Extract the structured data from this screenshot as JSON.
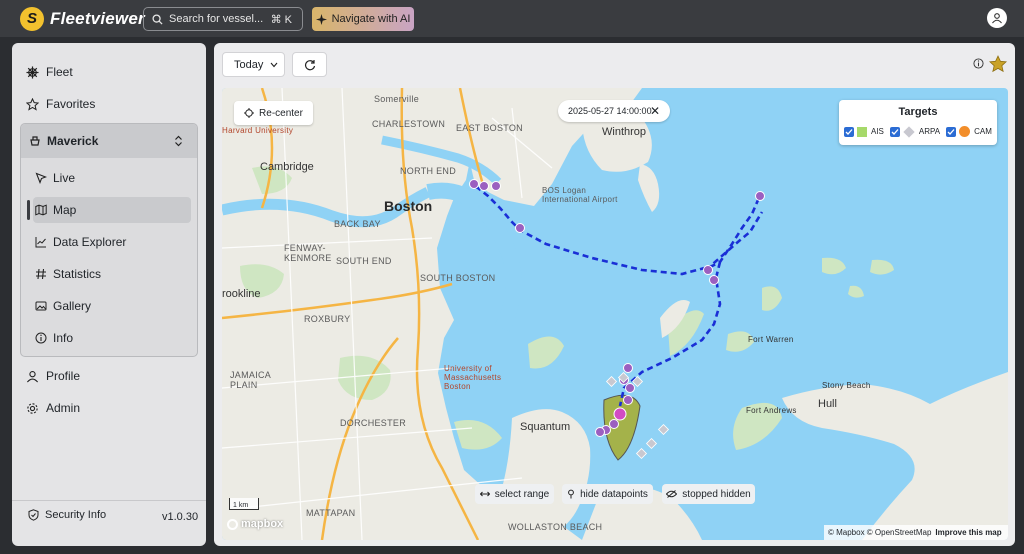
{
  "app": {
    "name": "Fleetviewer"
  },
  "header": {
    "search_placeholder": "Search for vessel...",
    "search_shortcut": "⌘ K",
    "ai_button": "Navigate with AI"
  },
  "sidebar": {
    "fleet": "Fleet",
    "favorites": "Favorites",
    "vessel": "Maverick",
    "vessel_items": [
      "Live",
      "Map",
      "Data Explorer",
      "Statistics",
      "Gallery",
      "Info"
    ],
    "active_item": "Map",
    "profile": "Profile",
    "admin": "Admin",
    "security_info": "Security Info",
    "version": "v1.0.30"
  },
  "toolbar": {
    "range": "Today"
  },
  "map": {
    "recenter": "Re-center",
    "timestamp": "2025-05-27 14:00:00",
    "targets": {
      "title": "Targets",
      "items": [
        {
          "label": "AIS",
          "color": "#a6d96a",
          "checked": true
        },
        {
          "label": "ARPA",
          "color": "#c8c8d0",
          "checked": true
        },
        {
          "label": "CAM",
          "color": "#f28e2b",
          "checked": true
        }
      ]
    },
    "labels": {
      "boston": "Boston",
      "cambridge": "Cambridge",
      "charlestown": "CHARLESTOWN",
      "north_end": "NORTH END",
      "east_boston": "EAST BOSTON",
      "back_bay": "BACK BAY",
      "fenway": "FENWAY-",
      "kenmore": "KENMORE",
      "south_end": "SOUTH END",
      "south_boston": "SOUTH BOSTON",
      "roxbury": "ROXBURY",
      "brookline": "rookline",
      "jamaica_plain": "JAMAICA PLAIN",
      "dorchester": "DORCHESTER",
      "mattapan": "MATTAPAN",
      "wollaston": "WOLLASTON BEACH",
      "squantum": "Squantum",
      "winthrop": "Winthrop",
      "fort_warren": "Fort Warren",
      "fort_andrews": "Fort Andrews",
      "hull": "Hull",
      "stony_beach": "Stony Beach",
      "harvard": "Harvard University",
      "umass": "University of Massachusetts Boston",
      "airport": "BOS Logan International Airport",
      "somerville": "Somerville",
      "back_bay_label": "BACK BAY"
    },
    "controls": {
      "select_range": "select range",
      "hide_datapoints": "hide datapoints",
      "stopped_hidden": "stopped hidden"
    },
    "scale": "1 km",
    "attribution": "© Mapbox © OpenStreetMap",
    "improve": "Improve this map",
    "mapbox_logo": "mapbox",
    "track_color": "#1a2fd6",
    "target_color": "#9b5fc0"
  }
}
